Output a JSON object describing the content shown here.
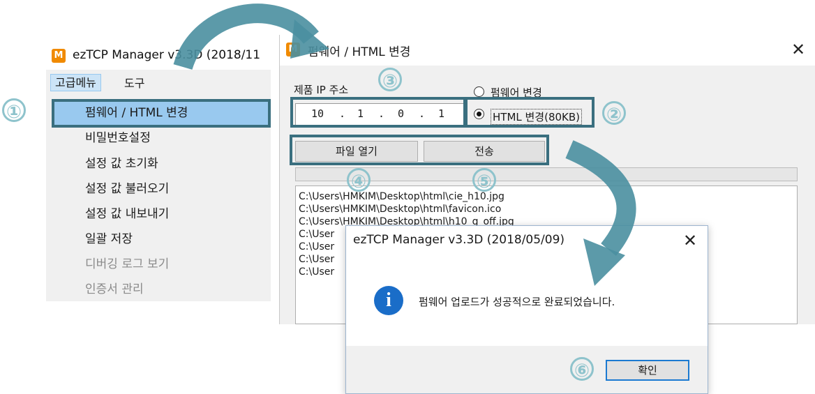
{
  "menu_window": {
    "logo": "M",
    "title": "ezTCP Manager v3.3D (2018/11",
    "menubar": [
      "고급메뉴",
      "도구"
    ],
    "items": [
      {
        "label": "펌웨어 / HTML 변경",
        "enabled": true,
        "highlighted": true
      },
      {
        "label": "비밀번호설정",
        "enabled": true
      },
      {
        "label": "설정 값 초기화",
        "enabled": true
      },
      {
        "label": "설정 값 불러오기",
        "enabled": true
      },
      {
        "label": "설정 값 내보내기",
        "enabled": true
      },
      {
        "label": "일괄 저장",
        "enabled": true
      },
      {
        "label": "디버깅 로그 보기",
        "enabled": false
      },
      {
        "label": "인증서 관리",
        "enabled": false
      }
    ]
  },
  "firmware_dialog": {
    "logo": "M",
    "title": "펌웨어 / HTML 변경",
    "close": "✕",
    "ip_label": "제품 IP 주소",
    "ip": [
      "10",
      "1",
      "0",
      "1"
    ],
    "radio_firmware": "펌웨어 변경",
    "radio_html": "HTML 변경(80KB)",
    "selected_radio": "html",
    "open_button": "파일 열기",
    "send_button": "전송",
    "files": [
      "C:\\Users\\HMKIM\\Desktop\\html\\cie_h10.jpg",
      "C:\\Users\\HMKIM\\Desktop\\html\\favicon.ico",
      "C:\\Users\\HMKIM\\Desktop\\html\\h10_g_off.jpg",
      "C:\\User",
      "C:\\User",
      "C:\\User",
      "C:\\User"
    ]
  },
  "message_box": {
    "title": "ezTCP Manager v3.3D (2018/05/09)",
    "close": "✕",
    "icon": "info-icon",
    "message": "펌웨어 업로드가 성공적으로 완료되었습니다.",
    "ok_button": "확인"
  },
  "annotations": {
    "step1": "①",
    "step2": "②",
    "step3": "③",
    "step4": "④",
    "step5": "⑤",
    "step6": "⑥",
    "highlight_color": "#3a6f7f",
    "number_color": "#8ec3cc"
  },
  "colors": {
    "menu_highlight": "#99c9ef",
    "info_icon": "#1a6dc8",
    "logo": "#f08a00",
    "arrow": "#4a8fa0"
  }
}
